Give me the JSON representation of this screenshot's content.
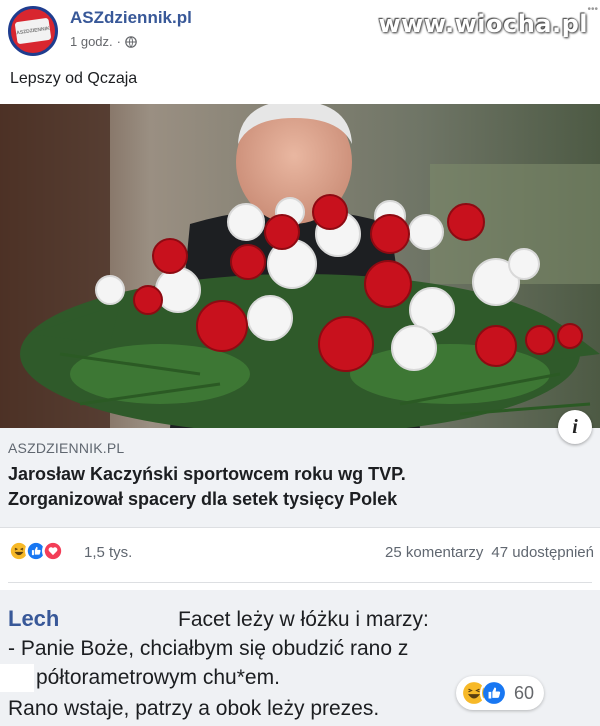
{
  "header": {
    "page_name": "ASZdziennik.pl",
    "time": "1 godz.",
    "separator": "·",
    "privacy_icon": "globe-icon",
    "watermark": "www.wiocha.pl",
    "avatar_text": "ASZDZIENNIK"
  },
  "post": {
    "text": "Lepszy od Qczaja"
  },
  "link": {
    "domain": "ASZDZIENNIK.PL",
    "title_line1": "Jarosław Kaczyński sportowcem roku wg TVP.",
    "title_line2": "Zorganizował spacery dla setek tysięcy Polek",
    "info_icon": "i"
  },
  "reactions": {
    "icons": [
      "haha-icon",
      "like-icon",
      "love-icon"
    ],
    "count": "1,5 tys.",
    "comments": "25 komentarzy",
    "shares": "47 udostępnień"
  },
  "comment": {
    "author": "Lech",
    "line1": "Facet leży w łóżku i marzy:",
    "line2": "- Panie Boże, chciałbym się obudzić rano z",
    "line3": "półtorametrowym chu*em.",
    "line4": "Rano wstaje, patrzy a obok leży prezes.",
    "reaction_icons": [
      "haha-icon",
      "like-icon"
    ],
    "reaction_count": "60"
  },
  "colors": {
    "brand_blue": "#385898",
    "like_blue": "#1877f2",
    "love_red": "#f33e58",
    "haha_yellow": "#f7b928",
    "avatar_red": "#d8262f"
  }
}
